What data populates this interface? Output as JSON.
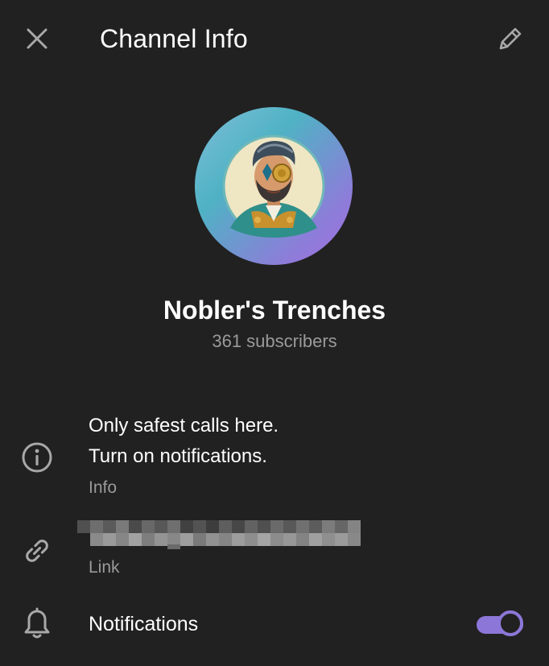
{
  "header": {
    "title": "Channel Info",
    "close_icon": "close-icon",
    "edit_icon": "pencil-icon"
  },
  "profile": {
    "channel_name": "Nobler's Trenches",
    "subscribers": "361 subscribers",
    "avatar_description_icon": "avatar-illustration"
  },
  "info": {
    "line1": "Only safest calls here.",
    "line2": "Turn on notifications.",
    "label": "Info",
    "icon": "info-icon"
  },
  "link": {
    "value": "",
    "label": "Link",
    "icon": "link-icon"
  },
  "notifications": {
    "label": "Notifications",
    "icon": "bell-icon",
    "enabled": true
  },
  "colors": {
    "background": "#212121",
    "accent": "#8c77d8",
    "secondary_text": "#9a9a9a",
    "primary_text": "#ffffff"
  }
}
